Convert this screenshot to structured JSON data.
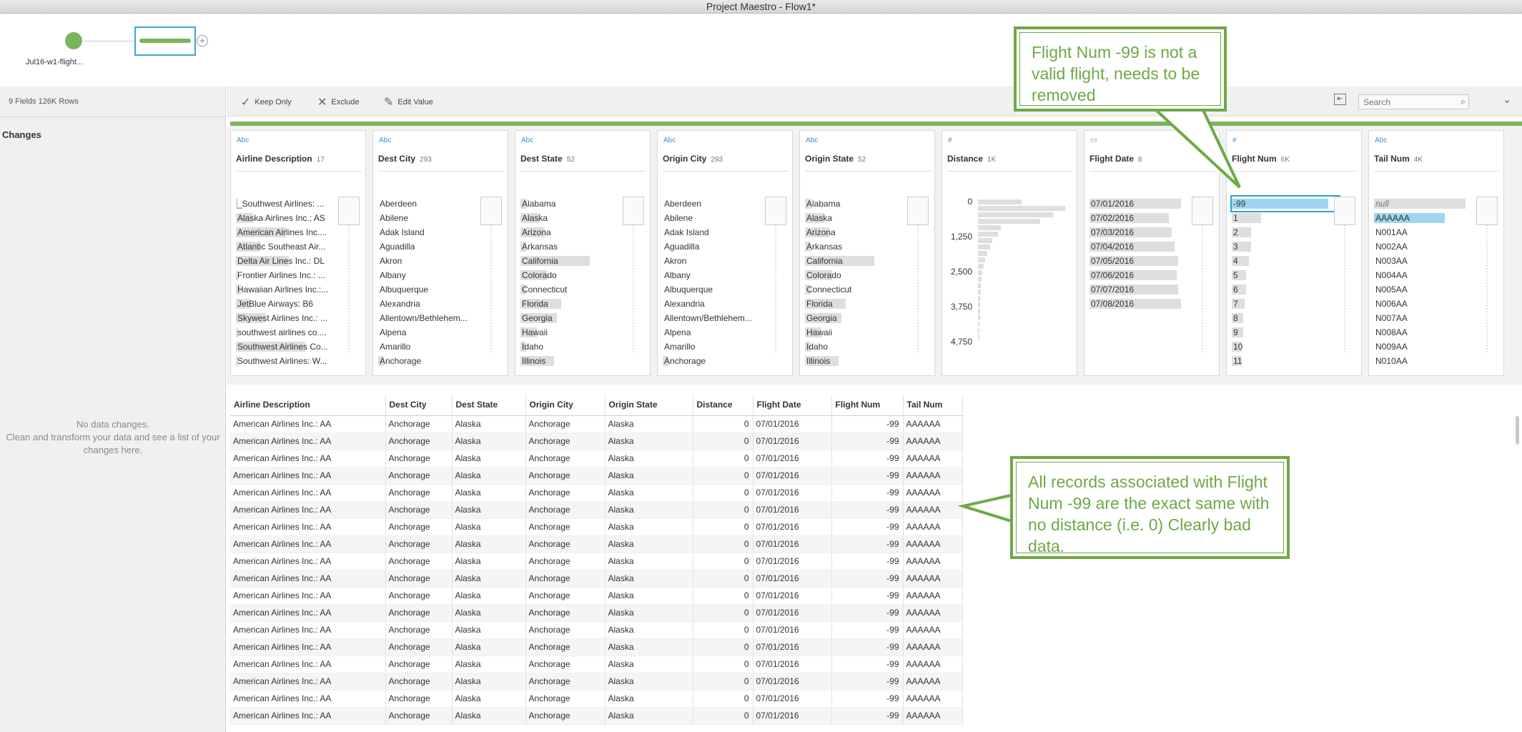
{
  "window": {
    "title": "Project Maestro - Flow1*"
  },
  "flow": {
    "input_label": "Jul16-w1-flight...",
    "add_symbol": "+"
  },
  "left_panel": {
    "stats": "9 Fields  126K Rows",
    "changes_title": "Changes",
    "no_changes_line1": "No data changes.",
    "no_changes_line2": "Clean and transform your data and see a list of your changes here."
  },
  "toolbar": {
    "keep_only": "Keep Only",
    "exclude": "Exclude",
    "edit_value": "Edit Value",
    "search_placeholder": "Search",
    "icons": {
      "keep_only": "checkmark-icon",
      "exclude": "x-icon",
      "edit_value": "pencil-icon",
      "search": "magnifier-icon",
      "collapse": "chevron-down-icon",
      "split": "split-view-icon"
    }
  },
  "profile": {
    "cards": [
      {
        "type": "Abc",
        "title": "Airline Description",
        "count": "17",
        "values": [
          "_Southwest Airlines: ...",
          "Alaska Airlines Inc.: AS",
          "American Airlines Inc....",
          "Atlantic Southeast Air...",
          "Delta Air Lines Inc.: DL",
          "Frontier Airlines Inc.: ...",
          "Hawaiian Airlines Inc.:...",
          "JetBlue Airways: B6",
          "Skywest Airlines Inc.: ...",
          "southwest airlines co....",
          "Southwest Airlines Co...",
          "Southwest Airlines: W..."
        ],
        "fill": [
          0.02,
          0.18,
          0.52,
          0.25,
          0.55,
          0.02,
          0.05,
          0.15,
          0.3,
          0.02,
          0.72,
          0.02
        ]
      },
      {
        "type": "Abc",
        "title": "Dest City",
        "count": "293",
        "values": [
          "Aberdeen",
          "Abilene",
          "Adak Island",
          "Aguadilla",
          "Akron",
          "Albany",
          "Albuquerque",
          "Alexandria",
          "Allentown/Bethlehem...",
          "Alpena",
          "Amarillo",
          "Anchorage"
        ],
        "fill": [
          0,
          0,
          0,
          0,
          0,
          0,
          0,
          0,
          0,
          0,
          0,
          0.06
        ]
      },
      {
        "type": "Abc",
        "title": "Dest State",
        "count": "52",
        "values": [
          "Alabama",
          "Alaska",
          "Arizona",
          "Arkansas",
          "California",
          "Colorado",
          "Connecticut",
          "Florida",
          "Georgia",
          "Hawaii",
          "Idaho",
          "Illinois"
        ],
        "fill": [
          0.07,
          0.2,
          0.25,
          0.06,
          0.72,
          0.28,
          0.06,
          0.42,
          0.38,
          0.17,
          0.06,
          0.35
        ]
      },
      {
        "type": "Abc",
        "title": "Origin City",
        "count": "293",
        "values": [
          "Aberdeen",
          "Abilene",
          "Adak Island",
          "Aguadilla",
          "Akron",
          "Albany",
          "Albuquerque",
          "Alexandria",
          "Allentown/Bethlehem...",
          "Alpena",
          "Amarillo",
          "Anchorage"
        ],
        "fill": [
          0,
          0,
          0,
          0,
          0,
          0,
          0,
          0,
          0,
          0,
          0,
          0.06
        ]
      },
      {
        "type": "Abc",
        "title": "Origin State",
        "count": "52",
        "values": [
          "Alabama",
          "Alaska",
          "Arizona",
          "Arkansas",
          "California",
          "Colorado",
          "Connecticut",
          "Florida",
          "Georgia",
          "Hawaii",
          "Idaho",
          "Illinois"
        ],
        "fill": [
          0.07,
          0.2,
          0.25,
          0.06,
          0.72,
          0.28,
          0.06,
          0.42,
          0.38,
          0.17,
          0.06,
          0.35
        ]
      },
      {
        "type": "#",
        "title": "Distance",
        "count": "1K",
        "axis": [
          "0",
          "1,250",
          "2,500",
          "3,750",
          "4,750"
        ],
        "hist": [
          0.48,
          0.95,
          0.82,
          0.68,
          0.25,
          0.22,
          0.16,
          0.13,
          0.1,
          0.08,
          0.06,
          0.05,
          0.04,
          0.03,
          0.03,
          0.02,
          0.02,
          0.02,
          0.02,
          0.01,
          0.01,
          0.01
        ]
      },
      {
        "type": "date",
        "title": "Flight Date",
        "count": "8",
        "values": [
          "07/01/2016",
          "07/02/2016",
          "07/03/2016",
          "07/04/2016",
          "07/05/2016",
          "07/06/2016",
          "07/07/2016",
          "07/08/2016"
        ],
        "fill": [
          0.95,
          0.82,
          0.85,
          0.88,
          0.92,
          0.9,
          0.92,
          0.95
        ]
      },
      {
        "type": "#",
        "title": "Flight Num",
        "count": "6K",
        "values": [
          "-99",
          "1",
          "2",
          "3",
          "4",
          "5",
          "6",
          "7",
          "8",
          "9",
          "10",
          "11"
        ],
        "fill": [
          1.0,
          0.3,
          0.2,
          0.2,
          0.18,
          0.15,
          0.15,
          0.13,
          0.12,
          0.12,
          0.1,
          0.1
        ]
      },
      {
        "type": "Abc",
        "title": "Tail Num",
        "count": "4K",
        "values": [
          "null",
          "AAAAAA",
          "N001AA",
          "N002AA",
          "N003AA",
          "N004AA",
          "N005AA",
          "N006AA",
          "N007AA",
          "N008AA",
          "N009AA",
          "N010AA"
        ],
        "fill": [
          0.95,
          0.73,
          0,
          0,
          0,
          0,
          0,
          0,
          0,
          0,
          0,
          0
        ]
      }
    ]
  },
  "grid": {
    "columns": [
      "Airline Description",
      "Dest City",
      "Dest State",
      "Origin City",
      "Origin State",
      "Distance",
      "Flight Date",
      "Flight Num",
      "Tail Num"
    ],
    "row": [
      "American Airlines Inc.: AA",
      "Anchorage",
      "Alaska",
      "Anchorage",
      "Alaska",
      "0",
      "07/01/2016",
      "-99",
      "AAAAAA"
    ],
    "row_count_visible": 18
  },
  "annotations": {
    "top": "Flight Num -99 is not a valid flight, needs to be removed",
    "bottom": "All records associated with Flight Num -99 are the exact same with no distance (i.e. 0) Clearly bad data."
  },
  "colors": {
    "accent_green": "#7ab55c",
    "callout_green": "#6fa845",
    "selection_blue": "#2da3d6",
    "type_blue": "#3f8fc4"
  }
}
